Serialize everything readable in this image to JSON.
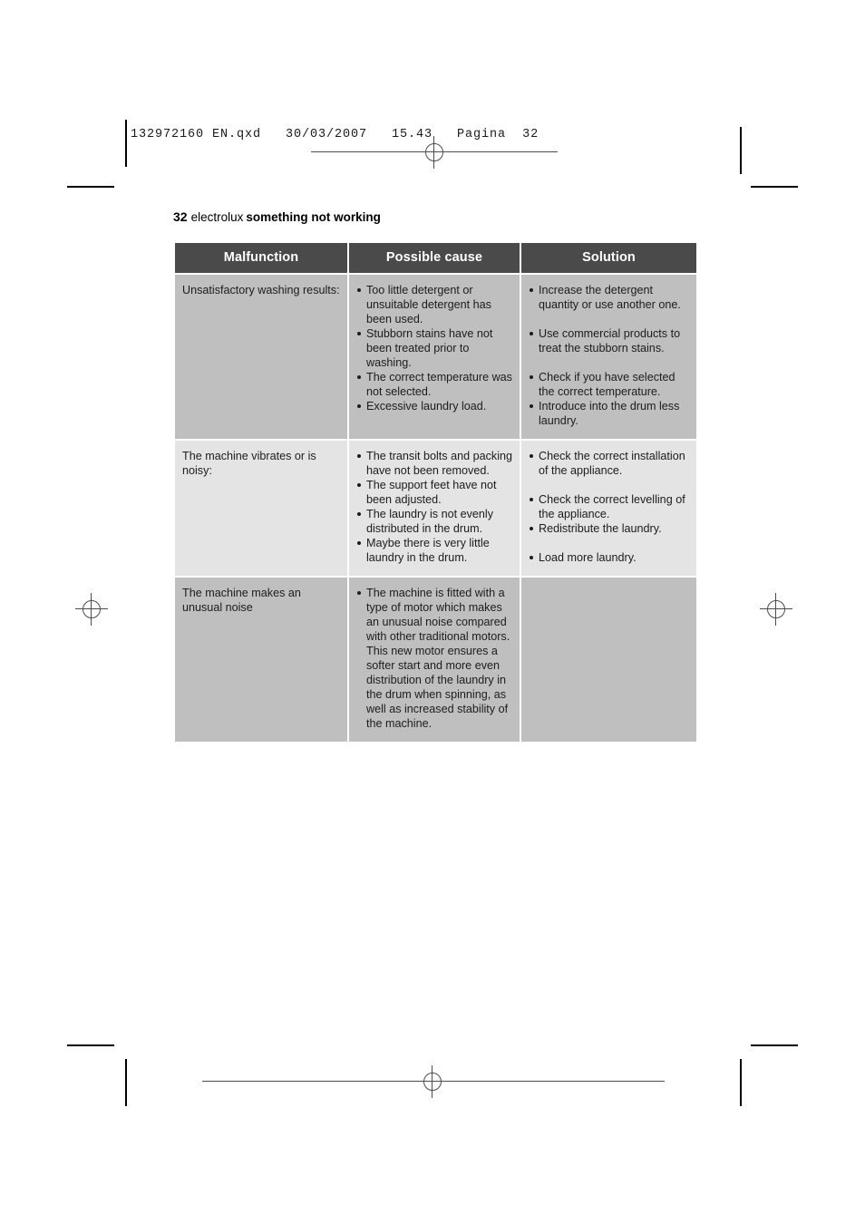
{
  "imposition": {
    "file_slug": "132972160 EN.qxd   30/03/2007   15.43   Pagina  32"
  },
  "page": {
    "number": "32",
    "brand": "electrolux",
    "section_title": "something not working"
  },
  "table": {
    "headers": {
      "malfunction": "Malfunction",
      "possible_cause": "Possible cause",
      "solution": "Solution"
    },
    "rows": [
      {
        "malfunction": "Unsatisfactory washing results:",
        "causes": [
          "Too little detergent or unsuitable detergent has been used.",
          "Stubborn stains have not been treated prior to washing.",
          "The correct temperature was not selected.",
          "Excessive laundry load."
        ],
        "solutions": [
          "Increase the detergent quantity or use another one.",
          "Use commercial products to treat the stubborn stains.",
          "Check if you have selected the correct temperature.",
          "Introduce into the drum less laundry."
        ]
      },
      {
        "malfunction": "The machine vibrates or is noisy:",
        "causes": [
          "The transit bolts and packing have not been removed.",
          "The support feet have not been adjusted.",
          "The laundry is not evenly distributed in the drum.",
          "Maybe there is very little laundry in the drum."
        ],
        "solutions": [
          "Check the correct installation of the appliance.",
          "Check the correct levelling of the appliance.",
          "Redistribute the laundry.",
          "Load more laundry."
        ]
      },
      {
        "malfunction": "The machine makes an unusual noise",
        "causes": [
          "The machine is fitted with a type of motor which makes an unusual noise compared with other traditional motors. This new motor ensures a softer start and more even distribution of the laundry in the drum when spinning, as well as increased stability of the machine."
        ],
        "solutions": []
      }
    ]
  },
  "colors": {
    "header_bar": "#4a4a4a",
    "row_shade_dark": "#bfbfbf",
    "row_shade_light": "#e4e4e4",
    "text": "#1c1c1c"
  }
}
